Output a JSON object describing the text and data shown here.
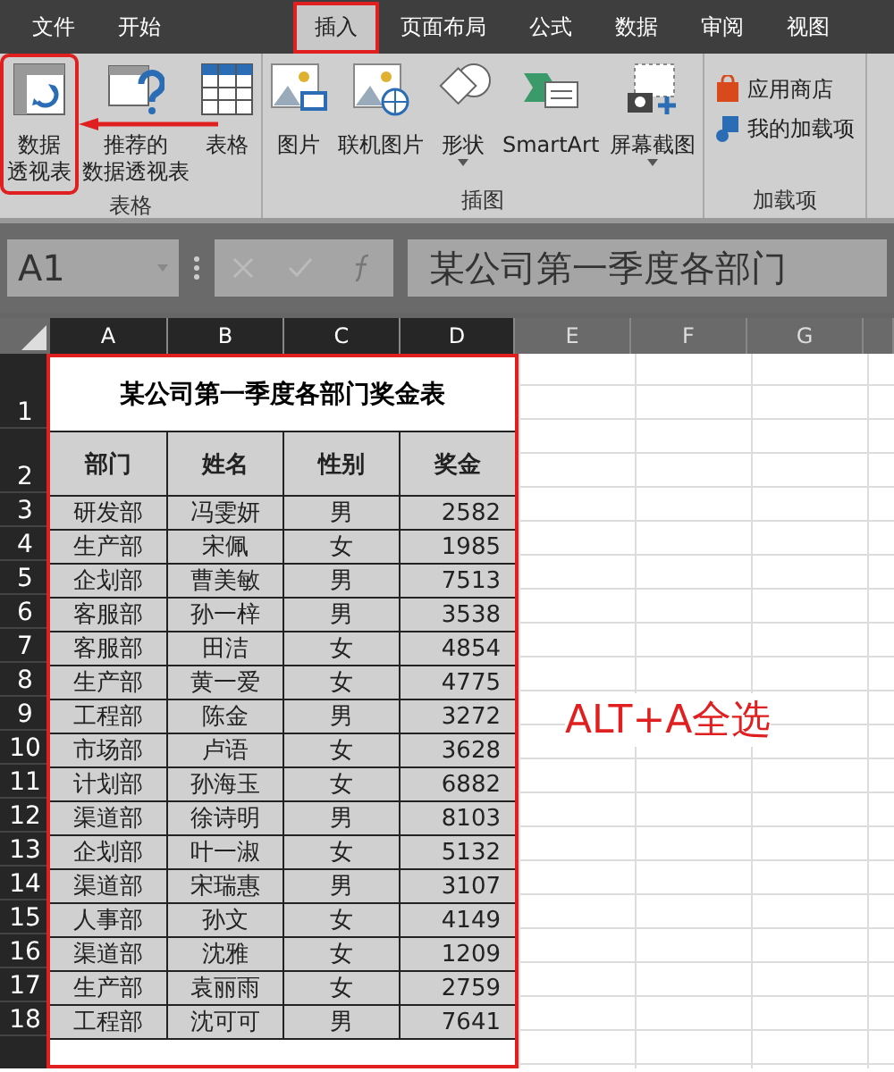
{
  "ribbon_tabs": [
    {
      "label": "文件",
      "selected": false,
      "highlighted": false
    },
    {
      "label": "开始",
      "selected": false,
      "highlighted": false
    },
    {
      "label": "插入",
      "selected": true,
      "highlighted": true
    },
    {
      "label": "页面布局",
      "selected": false,
      "highlighted": false
    },
    {
      "label": "公式",
      "selected": false,
      "highlighted": false
    },
    {
      "label": "数据",
      "selected": false,
      "highlighted": false
    },
    {
      "label": "审阅",
      "selected": false,
      "highlighted": false
    },
    {
      "label": "视图",
      "selected": false,
      "highlighted": false
    }
  ],
  "ribbon_groups": [
    {
      "label": "表格",
      "buttons": [
        {
          "kind": "pivot",
          "lines": [
            "数据",
            "透视表"
          ],
          "highlighted": true
        },
        {
          "kind": "recommended",
          "lines": [
            "推荐的",
            "数据透视表"
          ],
          "highlighted": false
        },
        {
          "kind": "table",
          "lines": [
            "表格"
          ],
          "highlighted": false
        }
      ]
    },
    {
      "label": "插图",
      "buttons": [
        {
          "kind": "picture",
          "lines": [
            "图片"
          ],
          "highlighted": false
        },
        {
          "kind": "online",
          "lines": [
            "联机图片"
          ],
          "highlighted": false
        },
        {
          "kind": "shapes",
          "lines": [
            "形状"
          ],
          "dropdown": true,
          "highlighted": false
        },
        {
          "kind": "smartart",
          "lines": [
            "SmartArt"
          ],
          "highlighted": false
        },
        {
          "kind": "screenshot",
          "lines": [
            "屏幕截图"
          ],
          "dropdown": true,
          "highlighted": false
        }
      ]
    },
    {
      "label": "加载项",
      "buttons": [
        {
          "kind": "store",
          "lines": [
            "应用商店"
          ],
          "highlighted": false
        },
        {
          "kind": "addins",
          "lines": [
            "我的加载项"
          ],
          "highlighted": false
        }
      ]
    }
  ],
  "formula_bar": {
    "name_box": "A1",
    "formula": "某公司第一季度各部门"
  },
  "columns": [
    {
      "label": "A",
      "selected": true
    },
    {
      "label": "B",
      "selected": true
    },
    {
      "label": "C",
      "selected": true
    },
    {
      "label": "D",
      "selected": true
    },
    {
      "label": "E",
      "selected": false
    },
    {
      "label": "F",
      "selected": false
    },
    {
      "label": "G",
      "selected": false
    }
  ],
  "sheet": {
    "title": "某公司第一季度各部门奖金表",
    "headers": [
      "部门",
      "姓名",
      "性别",
      "奖金"
    ],
    "rows": [
      [
        "研发部",
        "冯雯妍",
        "男",
        "2582"
      ],
      [
        "生产部",
        "宋佩",
        "女",
        "1985"
      ],
      [
        "企划部",
        "曹美敏",
        "男",
        "7513"
      ],
      [
        "客服部",
        "孙一梓",
        "男",
        "3538"
      ],
      [
        "客服部",
        "田洁",
        "女",
        "4854"
      ],
      [
        "生产部",
        "黄一爱",
        "女",
        "4775"
      ],
      [
        "工程部",
        "陈金",
        "男",
        "3272"
      ],
      [
        "市场部",
        "卢语",
        "女",
        "3628"
      ],
      [
        "计划部",
        "孙海玉",
        "女",
        "6882"
      ],
      [
        "渠道部",
        "徐诗明",
        "男",
        "8103"
      ],
      [
        "企划部",
        "叶一淑",
        "女",
        "5132"
      ],
      [
        "渠道部",
        "宋瑞惠",
        "男",
        "3107"
      ],
      [
        "人事部",
        "孙文",
        "女",
        "4149"
      ],
      [
        "渠道部",
        "沈雅",
        "女",
        "1209"
      ],
      [
        "生产部",
        "袁丽雨",
        "女",
        "2759"
      ],
      [
        "工程部",
        "沈可可",
        "男",
        "7641"
      ]
    ]
  },
  "row_numbers": [
    "1",
    "2",
    "3",
    "4",
    "5",
    "6",
    "7",
    "8",
    "9",
    "10",
    "11",
    "12",
    "13",
    "14",
    "15",
    "16",
    "17",
    "18"
  ],
  "annotation": "ALT+A全选"
}
